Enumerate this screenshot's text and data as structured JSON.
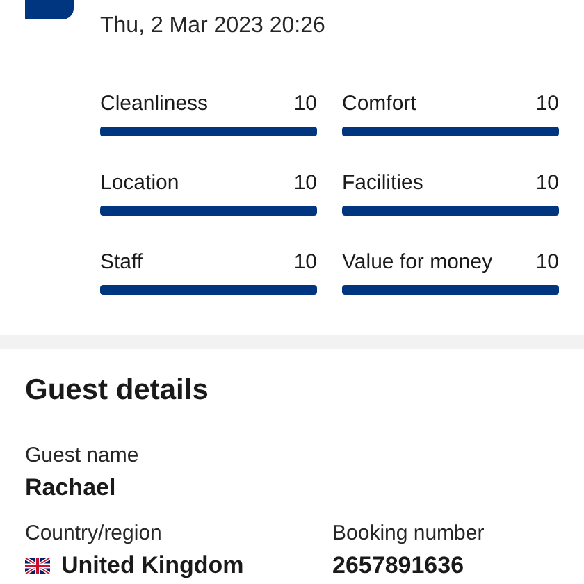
{
  "review": {
    "date": "Thu, 2 Mar 2023 20:26",
    "ratings": [
      {
        "label": "Cleanliness",
        "score": "10",
        "level": 1
      },
      {
        "label": "Comfort",
        "score": "10",
        "level": 1
      },
      {
        "label": "Location",
        "score": "10",
        "level": 1
      },
      {
        "label": "Facilities",
        "score": "10",
        "level": 1
      },
      {
        "label": "Staff",
        "score": "10",
        "level": 1
      },
      {
        "label": "Value for money",
        "score": "10",
        "level": 1
      }
    ]
  },
  "guest_details": {
    "title": "Guest details",
    "fields": [
      {
        "label": "Guest name",
        "value": "Rachael",
        "kind": "plain"
      },
      {
        "label": "Country/region",
        "value": "United Kingdom",
        "kind": "flag"
      },
      {
        "label": "Booking number",
        "value": "2657891636",
        "kind": "plain"
      }
    ]
  }
}
